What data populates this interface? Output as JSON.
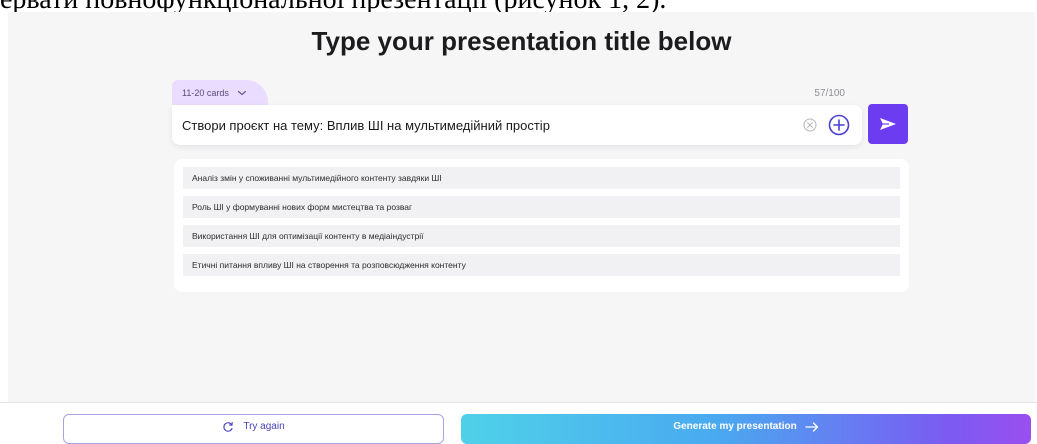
{
  "document": {
    "caption_text": "ервати повнофункціональної презентації (рисунок 1, 2)."
  },
  "app": {
    "title": "Type your presentation title below",
    "cards_selector": {
      "label": "11-20 cards"
    },
    "char_count": "57/100",
    "prompt": {
      "value": "Створи проєкт на тему: Вплив ШІ на мультимедійний простір"
    },
    "outline": {
      "items": [
        "Аналіз змін у споживанні мультимедійного контенту завдяки ШІ",
        "Роль ШІ у формуванні нових форм мистецтва та розваг",
        "Використання ШІ для оптимізації контенту в медіаіндустрії",
        "Етичні питання впливу ШІ на створення та розповсюдження контенту"
      ]
    },
    "actions": {
      "try_again_label": "Try again",
      "generate_label": "Generate my presentation"
    },
    "icons": {
      "cards_dropdown": "chevron-down-icon",
      "clear": "clear-icon",
      "add": "add-icon",
      "send": "send-icon",
      "try_again": "refresh-icon",
      "generate": "arrow-right-icon"
    },
    "colors": {
      "accent": "#6b3cf0",
      "tab_background": "#eadcff",
      "canvas_background": "#f6f6f7",
      "try_again_border": "#a9a3e6"
    }
  }
}
